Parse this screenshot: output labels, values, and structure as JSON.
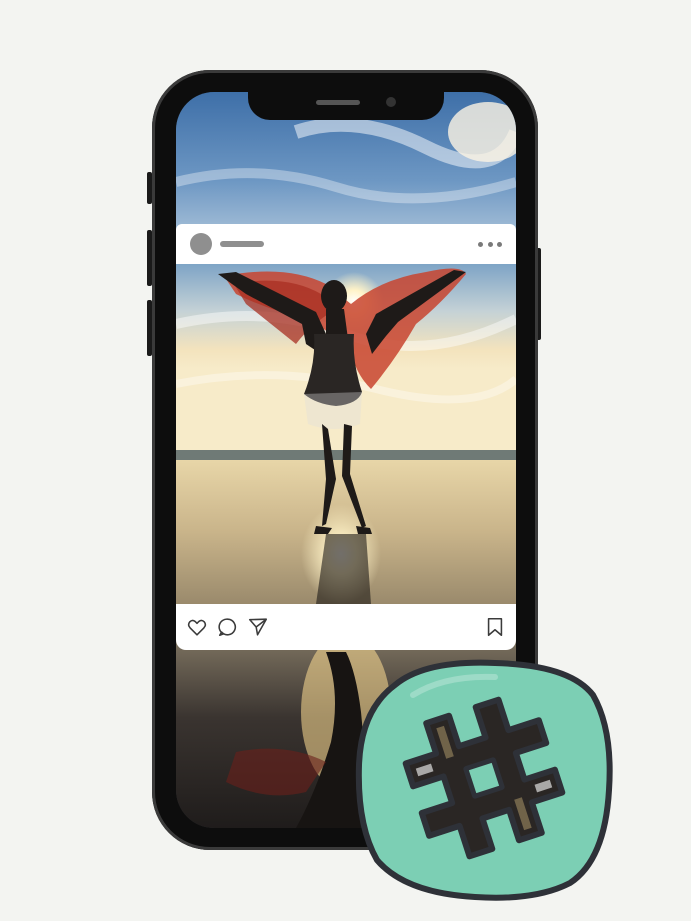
{
  "colors": {
    "background": "#f3f4f1",
    "phone_body": "#0d0d0d",
    "card": "#ffffff",
    "placeholder_gray": "#8f8f8f",
    "icon_gray": "#3b3b3b",
    "badge_fill": "#7ccfb4",
    "badge_outline": "#2e3138"
  },
  "post": {
    "header": {
      "avatar_icon": "avatar-placeholder",
      "username_placeholder": "gray-bar",
      "more_icon": "more-horizontal-icon"
    },
    "image": {
      "subject": "silhouette-with-red-scarf-on-beach-at-sunset"
    },
    "actions": {
      "like_icon": "heart-icon",
      "comment_icon": "comment-bubble-icon",
      "share_icon": "paper-plane-icon",
      "save_icon": "bookmark-icon"
    }
  },
  "badge": {
    "icon": "hashtag-icon"
  }
}
